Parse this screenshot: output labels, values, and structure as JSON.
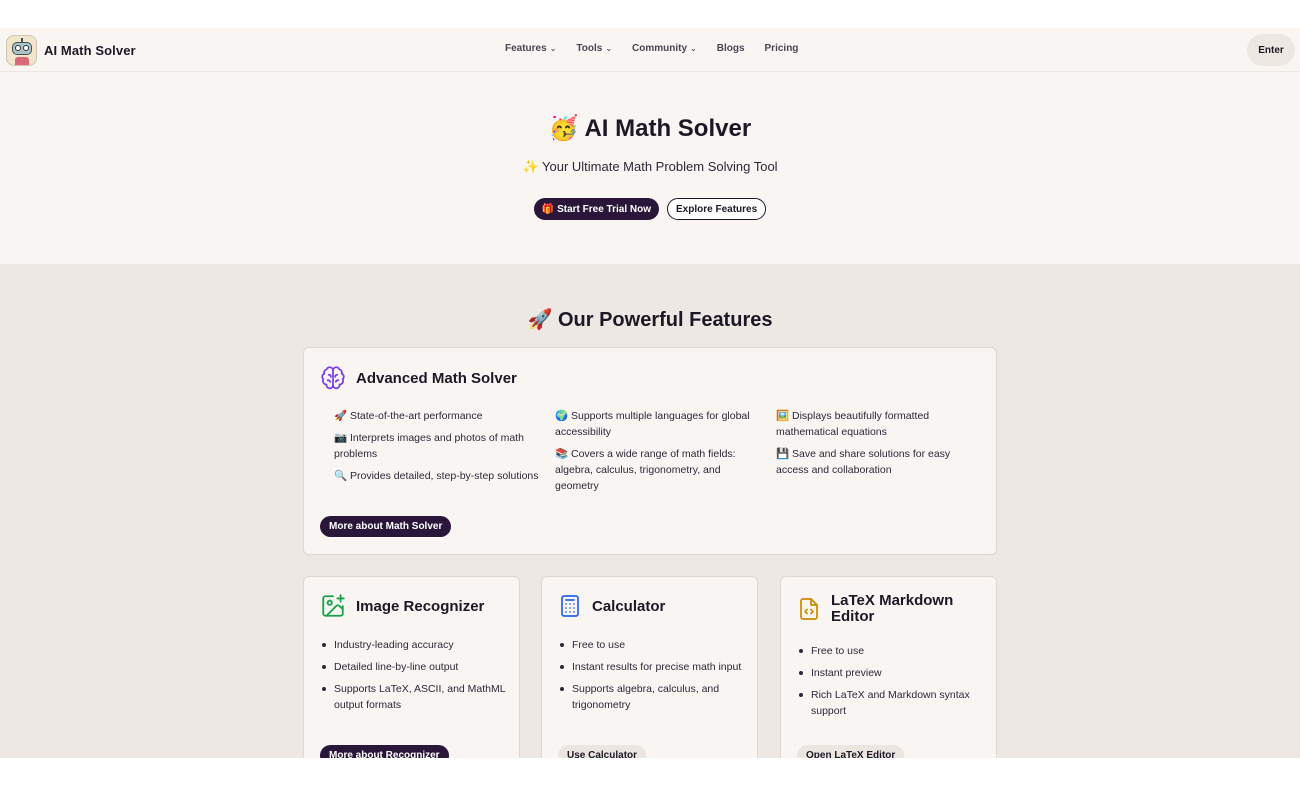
{
  "nav": {
    "brand": "AI Math Solver",
    "items": [
      {
        "label": "Features",
        "dropdown": true
      },
      {
        "label": "Tools",
        "dropdown": true
      },
      {
        "label": "Community",
        "dropdown": true
      },
      {
        "label": "Blogs",
        "dropdown": false
      },
      {
        "label": "Pricing",
        "dropdown": false
      }
    ],
    "enter_label": "Enter"
  },
  "hero": {
    "title": "🥳 AI Math Solver",
    "subtitle": "✨ Your Ultimate Math Problem Solving Tool",
    "primary_cta": "🎁 Start Free Trial Now",
    "secondary_cta": "Explore Features"
  },
  "features": {
    "title": "🚀 Our Powerful Features",
    "main_card": {
      "title": "Advanced Math Solver",
      "icon": "brain-icon",
      "columns": [
        [
          "🚀 State-of-the-art performance",
          "📷 Interprets images and photos of math problems",
          "🔍 Provides detailed, step-by-step solutions"
        ],
        [
          "🌍 Supports multiple languages for global accessibility",
          "📚 Covers a wide range of math fields: algebra, calculus, trigonometry, and geometry"
        ],
        [
          "🖼️ Displays beautifully formatted mathematical equations",
          "💾 Save and share solutions for easy access and collaboration"
        ]
      ],
      "button": "More about Math Solver"
    },
    "cards": [
      {
        "title": "Image Recognizer",
        "icon": "image-plus-icon",
        "bullets": [
          "Industry-leading accuracy",
          "Detailed line-by-line output",
          "Supports LaTeX, ASCII, and MathML output formats"
        ],
        "button": "More about Recognizer"
      },
      {
        "title": "Calculator",
        "icon": "calculator-icon",
        "bullets": [
          "Free to use",
          "Instant results for precise math input",
          "Supports algebra, calculus, and trigonometry"
        ],
        "button": "Use Calculator"
      },
      {
        "title": "LaTeX Markdown Editor",
        "icon": "code-file-icon",
        "bullets": [
          "Free to use",
          "Instant preview",
          "Rich LaTeX and Markdown syntax support"
        ],
        "button": "Open LaTeX Editor"
      }
    ]
  },
  "colors": {
    "accent_dark": "#2a1638",
    "hero_bg": "#f8f5f3",
    "section_bg": "#ede8e3",
    "brain_icon": "#7c3aed",
    "image_icon": "#16a34a",
    "calculator_icon": "#2563eb",
    "editor_icon": "#ca8a04"
  }
}
